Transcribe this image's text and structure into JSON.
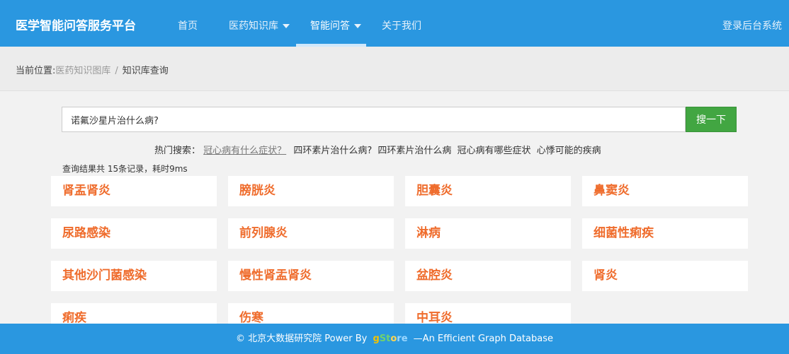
{
  "header": {
    "brand": "医学智能问答服务平台",
    "nav": [
      {
        "label": "首页",
        "dropdown": false,
        "active": false
      },
      {
        "label": "医药知识库",
        "dropdown": true,
        "active": false
      },
      {
        "label": "智能问答",
        "dropdown": true,
        "active": true
      },
      {
        "label": "关于我们",
        "dropdown": false,
        "active": false
      }
    ],
    "login": "登录后台系统"
  },
  "breadcrumb": {
    "prefix": "当前位置:",
    "link": "医药知识图库",
    "separator": "/",
    "current": "知识库查询"
  },
  "search": {
    "value": "诺氟沙星片治什么病?",
    "button": "搜一下"
  },
  "hot_search": {
    "label": "热门搜索：",
    "link": "冠心病有什么症状？",
    "terms": [
      "四环素片治什么病?",
      "四环素片治什么病",
      "冠心病有哪些症状",
      "心悸可能的疾病"
    ]
  },
  "results": {
    "summary": "查询结果共 15条记录，耗时9ms",
    "items": [
      "肾盂肾炎",
      "膀胱炎",
      "胆囊炎",
      "鼻窦炎",
      "尿路感染",
      "前列腺炎",
      "淋病",
      "细菌性痢疾",
      "其他沙门菌感染",
      "慢性肾盂肾炎",
      "盆腔炎",
      "肾炎",
      "痢疾",
      "伤寒",
      "中耳炎"
    ]
  },
  "footer": {
    "copyright": "© 北京大数据研究院 Power By",
    "logo": {
      "g": "g",
      "s": "St",
      "t": "o",
      "re": "re"
    },
    "tagline": "—An Efficient Graph Database"
  },
  "colors": {
    "header_bg": "#2a97e0",
    "search_button": "#42a642",
    "result_text": "#ef6c2c",
    "page_bg": "#f2f2f2"
  }
}
